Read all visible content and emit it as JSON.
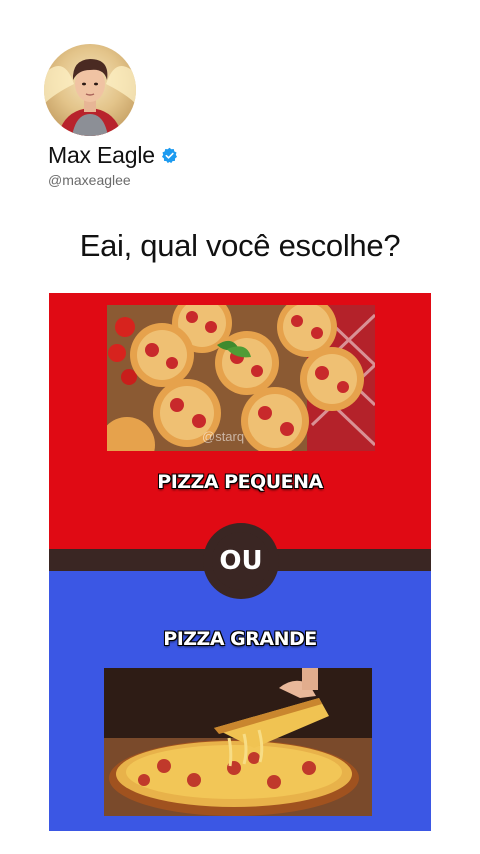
{
  "profile": {
    "name": "Max Eagle",
    "handle": "@maxeaglee",
    "avatar_icon": "profile-photo",
    "verified_icon": "verified-badge-icon",
    "verified_color": "#1d9bf0"
  },
  "post": {
    "question": "Eai, qual você escolhe?"
  },
  "meme": {
    "top_color": "#e00a14",
    "bottom_color": "#3b57e4",
    "divider_color": "#3a2623",
    "option_a": {
      "label": "PIZZA PEQUENA",
      "image": "small-pizzas-photo",
      "watermark": "@starq"
    },
    "separator": "OU",
    "option_b": {
      "label": "PIZZA GRANDE",
      "image": "large-pizza-photo"
    }
  }
}
